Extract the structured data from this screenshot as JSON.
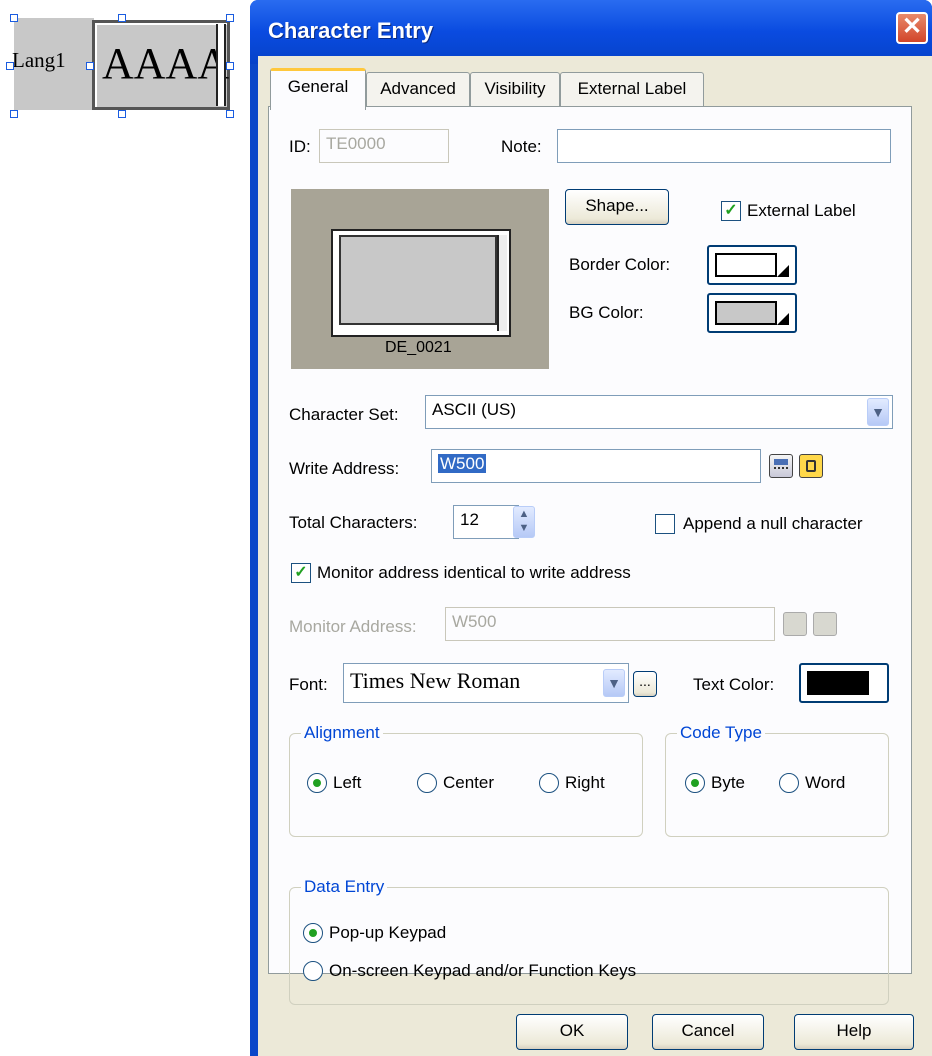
{
  "canvas_object": {
    "lang_label": "Lang1",
    "preview_text": "AAAA"
  },
  "window": {
    "title": "Character Entry",
    "close_glyph": "✕"
  },
  "tabs": [
    {
      "label": "General",
      "active": true
    },
    {
      "label": "Advanced",
      "active": false
    },
    {
      "label": "Visibility",
      "active": false
    },
    {
      "label": "External Label",
      "active": false
    }
  ],
  "general": {
    "id_label": "ID:",
    "id_value": "TE0000",
    "note_label": "Note:",
    "note_value": "",
    "shape_name": "DE_0021",
    "shape_button": "Shape...",
    "external_label": "External Label",
    "external_label_checked": true,
    "border_color_label": "Border Color:",
    "border_color": "#ffffff",
    "bg_color_label": "BG Color:",
    "bg_color": "#c8c8c8",
    "charset_label": "Character Set:",
    "charset_value": "ASCII (US)",
    "write_address_label": "Write Address:",
    "write_address_value": "W500",
    "total_chars_label": "Total Characters:",
    "total_chars_value": "12",
    "append_null_label": "Append a null character",
    "append_null_checked": false,
    "monitor_identical_label": "Monitor address identical to write address",
    "monitor_identical_checked": true,
    "monitor_address_label": "Monitor Address:",
    "monitor_address_value": "W500",
    "font_label": "Font:",
    "font_value": "Times New Roman",
    "ellipsis": "...",
    "text_color_label": "Text Color:",
    "text_color": "#000000"
  },
  "alignment": {
    "title": "Alignment",
    "options": [
      "Left",
      "Center",
      "Right"
    ],
    "selected": "Left"
  },
  "code_type": {
    "title": "Code Type",
    "options": [
      "Byte",
      "Word"
    ],
    "selected": "Byte"
  },
  "data_entry": {
    "title": "Data Entry",
    "options": [
      "Pop-up Keypad",
      "On-screen Keypad and/or Function Keys"
    ],
    "selected": "Pop-up Keypad"
  },
  "buttons": {
    "ok": "OK",
    "cancel": "Cancel",
    "help": "Help"
  },
  "icons": [
    "calculator-icon",
    "address-book-icon",
    "spin-up-icon",
    "spin-down-icon",
    "dropdown-arrow-icon",
    "close-icon"
  ]
}
